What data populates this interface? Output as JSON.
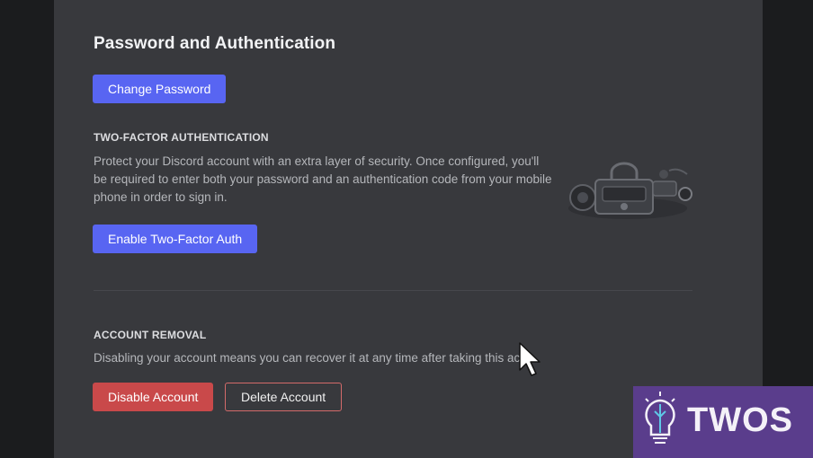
{
  "page": {
    "title": "Password and Authentication",
    "change_password_label": "Change Password"
  },
  "two_factor": {
    "heading": "TWO-FACTOR AUTHENTICATION",
    "description_lines": [
      "Protect your Discord account with an extra layer of security. Once configured, you'll",
      "be required to enter both your password and an authentication code from your mobile",
      "phone in order to sign in."
    ],
    "enable_label": "Enable Two-Factor Auth",
    "illustration_icon": "2fa-lock-illustration-icon"
  },
  "account_removal": {
    "heading": "ACCOUNT REMOVAL",
    "description": "Disabling your account means you can recover it at any time after taking this acti",
    "disable_label": "Disable Account",
    "delete_label": "Delete Account"
  },
  "watermark": {
    "text": "TWOS"
  },
  "colors": {
    "blurple": "#5865f2",
    "danger": "#c9494a",
    "panel": "#38393d",
    "watermark_bg": "#5a3d8c"
  }
}
